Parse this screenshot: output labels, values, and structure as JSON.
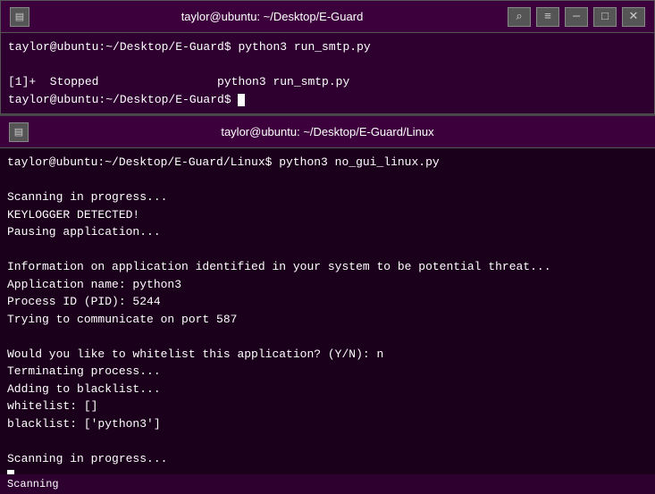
{
  "window1": {
    "title": "taylor@ubuntu: ~/Desktop/E-Guard",
    "icon": "▤",
    "buttons": {
      "search": "🔍",
      "menu": "☰",
      "minimize": "─",
      "maximize": "□",
      "close": "✕"
    },
    "lines": [
      "taylor@ubuntu:~/Desktop/E-Guard$ python3 run_smtp.py",
      "",
      "[1]+  Stopped                 python3 run_smtp.py",
      "taylor@ubuntu:~/Desktop/E-Guard$ "
    ]
  },
  "window2": {
    "title": "taylor@ubuntu: ~/Desktop/E-Guard/Linux",
    "icon": "▤",
    "lines": [
      "taylor@ubuntu:~/Desktop/E-Guard/Linux$ python3 no_gui_linux.py",
      "",
      "Scanning in progress...",
      "KEYLOGGER DETECTED!",
      "Pausing application...",
      "",
      "Information on application identified in your system to be potential threat...",
      "Application name: python3",
      "Process ID (PID): 5244",
      "Trying to communicate on port 587",
      "",
      "Would you like to whitelist this application? (Y/N): n",
      "Terminating process...",
      "Adding to blacklist...",
      "whitelist: []",
      "blacklist: ['python3']",
      "",
      "Scanning in progress..."
    ]
  },
  "statusbar": {
    "text": "Scanning"
  }
}
